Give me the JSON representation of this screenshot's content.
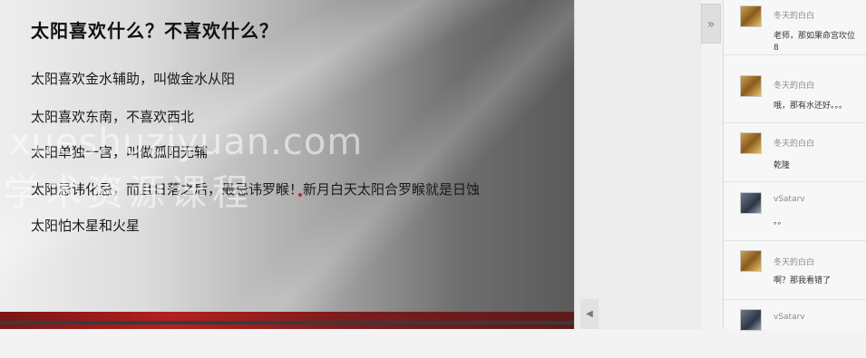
{
  "slide": {
    "title": "太阳喜欢什么？不喜欢什么？",
    "lines": [
      "太阳喜欢金水辅助，叫做金水从阳",
      "太阳喜欢东南，不喜欢西北",
      "太阳单独一宫，叫做孤阳无辅",
      "太阳忌讳化忌，而且日落之后，最忌讳罗睺！新月白天太阳合罗睺就是日蚀",
      "太阳怕木星和火星"
    ]
  },
  "watermark": {
    "line1": "xueshuziyuan.com",
    "line2": "学术资源课程"
  },
  "toolbar": {
    "expand_glyph": "»",
    "scroll_left_glyph": "◀"
  },
  "chat": {
    "messages": [
      {
        "user": "冬天的白白",
        "text": "老师，那如果命宫坎位\n8",
        "avatar": "gold"
      },
      {
        "user": "冬天的白白",
        "text": "哦，那有水还好。。。",
        "avatar": "gold"
      },
      {
        "user": "冬天的白白",
        "text": "乾隆",
        "avatar": "gold"
      },
      {
        "user": "vSatarv",
        "text": "。。",
        "avatar": "dark"
      },
      {
        "user": "冬天的白白",
        "text": "啊？那我看错了",
        "avatar": "gold"
      },
      {
        "user": "vSatarv",
        "text": "",
        "avatar": "dark"
      }
    ]
  }
}
